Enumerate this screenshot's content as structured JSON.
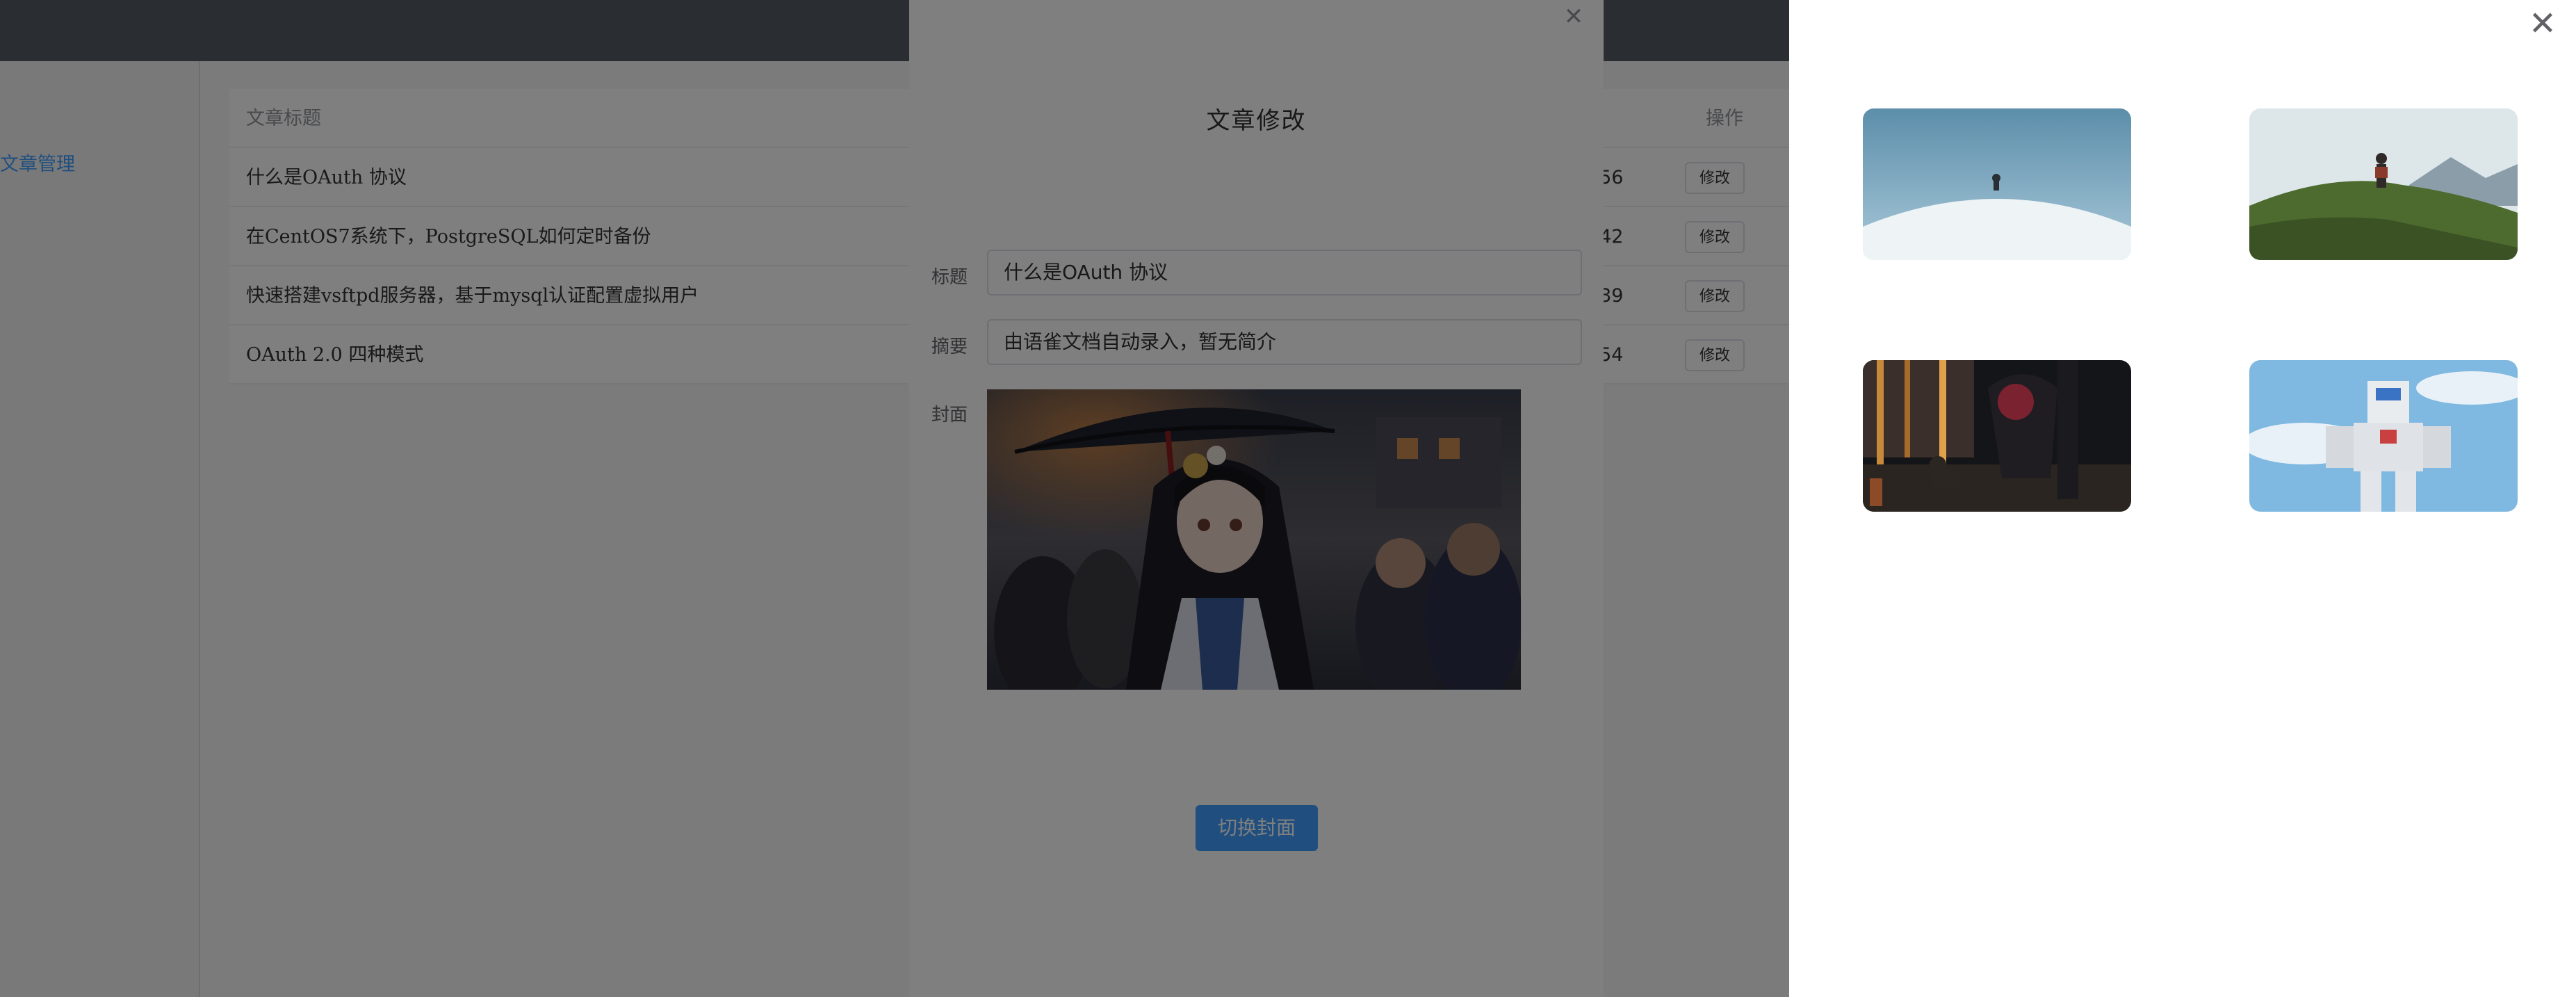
{
  "sidebar": {
    "items": [
      {
        "label": "文章管理"
      }
    ]
  },
  "table": {
    "headers": {
      "title": "文章标题",
      "ops": "操作"
    },
    "rows": [
      {
        "title": "什么是OAuth 协议",
        "time": ":56",
        "action": "修改"
      },
      {
        "title": "在CentOS7系统下，PostgreSQL如何定时备份",
        "time": ":42",
        "action": "修改"
      },
      {
        "title": "快速搭建vsftpd服务器，基于mysql认证配置虚拟用户",
        "time": ":39",
        "action": "修改"
      },
      {
        "title": "OAuth 2.0 四种模式",
        "time": ":54",
        "action": "修改"
      }
    ]
  },
  "dialog": {
    "title": "文章修改",
    "fields": {
      "title_label": "标题",
      "title_value": "什么是OAuth 协议",
      "summary_label": "摘要",
      "summary_value": "由语雀文档自动录入，暂无简介",
      "cover_label": "封面"
    },
    "switch_cover_button": "切换封面",
    "close_icon": "close-icon"
  },
  "drawer": {
    "close_icon": "close-icon",
    "thumbnails": [
      {
        "name": "snow-hill-thumbnail"
      },
      {
        "name": "mountain-hiker-thumbnail"
      },
      {
        "name": "rainy-street-cat-thumbnail"
      },
      {
        "name": "robot-sky-thumbnail"
      }
    ]
  },
  "colors": {
    "primary": "#409eff",
    "topbar": "#545c64",
    "mask": "rgba(0,0,0,0.5)"
  }
}
